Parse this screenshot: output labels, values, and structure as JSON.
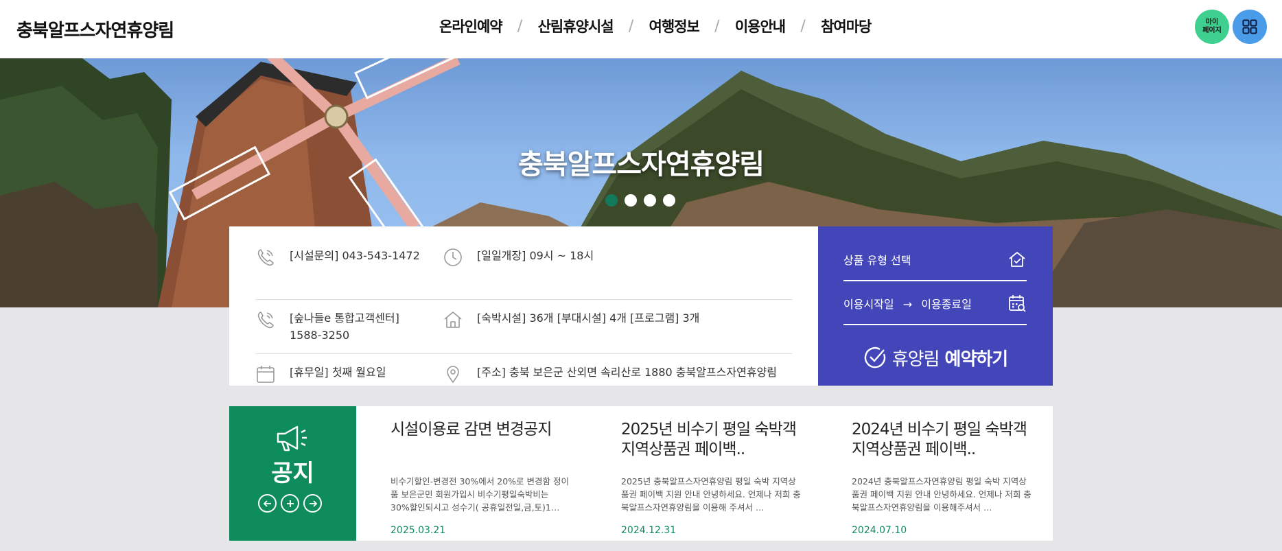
{
  "header": {
    "logo": "충북알프스자연휴양림",
    "nav": [
      "온라인예약",
      "산림휴양시설",
      "여행정보",
      "이용안내",
      "참여마당"
    ],
    "nav_separator": "/",
    "mypage_line1": "마이",
    "mypage_line2": "페이지",
    "allmenu_icon": "grid-icon"
  },
  "hero": {
    "title": "충북알프스자연휴양림",
    "slide_count": 4,
    "active_slide": 1
  },
  "info": {
    "phone": "[시설문의] 043-543-1472",
    "hours": "[일일개장] 09시 ~ 18시",
    "call_center": "[숲나들e 통합고객센터] 1588-3250",
    "facilities": "[숙박시설] 36개 [부대시설] 4개 [프로그램] 3개",
    "closed": "[휴무일] 첫째 월요일",
    "address": "[주소] 충북 보은군 산외면 속리산로 1880 충북알프스자연휴양림"
  },
  "reserve": {
    "product_type": "상품 유형 선택",
    "start_date": "이용시작일",
    "arrow": "→",
    "end_date": "이용종료일",
    "button_prefix": "휴양림",
    "button_bold": "예약하기"
  },
  "notice": {
    "tag": "공지",
    "items": [
      {
        "title": "시설이용료 감면 변경공지",
        "desc": "비수기할인-변경전 30%에서 20%로 변경함 정이품 보은군민 회원가입시 비수기평일숙박비는 30%할인되시고 성수기( 공휴일전일,금,토)1…",
        "date": "2025.03.21"
      },
      {
        "title": "2025년 비수기 평일 숙박객 지역상품권 페이백..",
        "desc": "2025년 충북알프스자연휴양림 평일 숙박 지역상품권 페이백 지원 안내 안녕하세요. 언제나 저희 충북알프스자연휴양림을 이용해 주셔서 …",
        "date": "2024.12.31"
      },
      {
        "title": "2024년 비수기 평일 숙박객 지역상품권 페이백..",
        "desc": "2024년 충북알프스자연휴양림 평일 숙박 지역상품권 페이백 지원 안내 안녕하세요. 언제나 저희 충북알프스자연휴양림을 이용해주셔서 …",
        "date": "2024.07.10"
      }
    ]
  },
  "colors": {
    "brand_green": "#0f8c5c",
    "reserve_blue": "#4346b8",
    "mypage_green": "#3fcf8e",
    "allmenu_blue": "#4a9be8"
  }
}
